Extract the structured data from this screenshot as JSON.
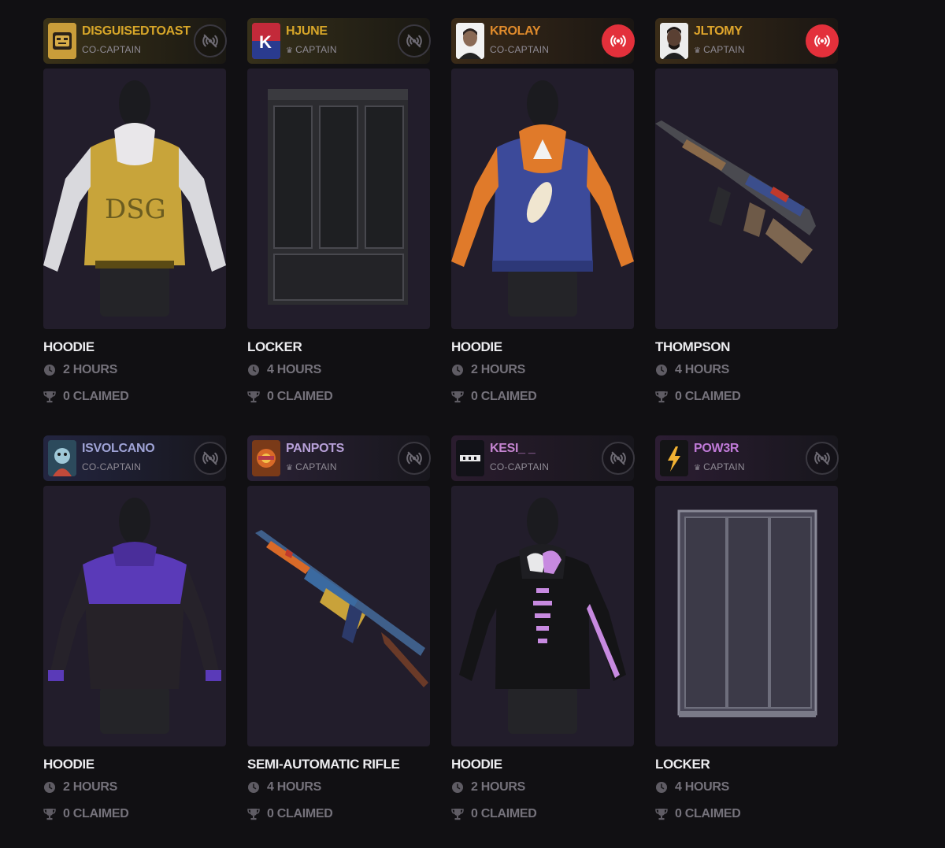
{
  "cards": [
    {
      "streamer": "DISGUISEDTOAST",
      "role": "CO-CAPTAIN",
      "captain": false,
      "live": false,
      "name_color": "#d7a629",
      "header_gradient": [
        "#3a3218",
        "#1a1813"
      ],
      "avatar": "toast-face-icon",
      "item": "HOODIE",
      "hours": "2 HOURS",
      "claimed": "0 CLAIMED"
    },
    {
      "streamer": "HJUNE",
      "role": "CAPTAIN",
      "captain": true,
      "live": false,
      "name_color": "#d7a629",
      "header_gradient": [
        "#36301a",
        "#1a1813"
      ],
      "avatar": "k-logo-icon",
      "item": "LOCKER",
      "hours": "4 HOURS",
      "claimed": "0 CLAIMED"
    },
    {
      "streamer": "KROLAY",
      "role": "CO-CAPTAIN",
      "captain": false,
      "live": true,
      "name_color": "#e08b2c",
      "header_gradient": [
        "#3a2a18",
        "#1a1613"
      ],
      "avatar": "person-photo-icon",
      "item": "HOODIE",
      "hours": "2 HOURS",
      "claimed": "0 CLAIMED"
    },
    {
      "streamer": "JLTOMY",
      "role": "CAPTAIN",
      "captain": true,
      "live": true,
      "name_color": "#e0a62c",
      "header_gradient": [
        "#3a2c18",
        "#1a1613"
      ],
      "avatar": "person-photo-icon",
      "item": "THOMPSON",
      "hours": "4 HOURS",
      "claimed": "0 CLAIMED"
    },
    {
      "streamer": "ISVOLCANO",
      "role": "CO-CAPTAIN",
      "captain": false,
      "live": false,
      "name_color": "#9fa3d6",
      "header_gradient": [
        "#232540",
        "#17161c"
      ],
      "avatar": "character-art-icon",
      "item": "HOODIE",
      "hours": "2 HOURS",
      "claimed": "0 CLAIMED"
    },
    {
      "streamer": "PANPOTS",
      "role": "CAPTAIN",
      "captain": true,
      "live": false,
      "name_color": "#b7a0d8",
      "header_gradient": [
        "#2b2236",
        "#17161c"
      ],
      "avatar": "panpots-logo-icon",
      "item": "SEMI-AUTOMATIC RIFLE",
      "hours": "4 HOURS",
      "claimed": "0 CLAIMED"
    },
    {
      "streamer": "KESI_ _",
      "role": "CO-CAPTAIN",
      "captain": false,
      "live": false,
      "name_color": "#c584d0",
      "header_gradient": [
        "#2a1c2e",
        "#17161c"
      ],
      "avatar": "kesi-logo-icon",
      "item": "HOODIE",
      "hours": "2 HOURS",
      "claimed": "0 CLAIMED"
    },
    {
      "streamer": "POW3R",
      "role": "CAPTAIN",
      "captain": true,
      "live": false,
      "name_color": "#c07ad8",
      "header_gradient": [
        "#2c1d33",
        "#17161c"
      ],
      "avatar": "lightning-logo-icon",
      "item": "LOCKER",
      "hours": "4 HOURS",
      "claimed": "0 CLAIMED"
    }
  ],
  "icons": {
    "time": "clock-icon",
    "claimed": "trophy-icon",
    "live_off": "broadcast-off-icon",
    "live_on": "broadcast-icon",
    "captain": "crown-icon"
  },
  "colors": {
    "background": "#111013",
    "panel": "#221d2b",
    "live": "#e3303b",
    "muted": "#75727b"
  }
}
